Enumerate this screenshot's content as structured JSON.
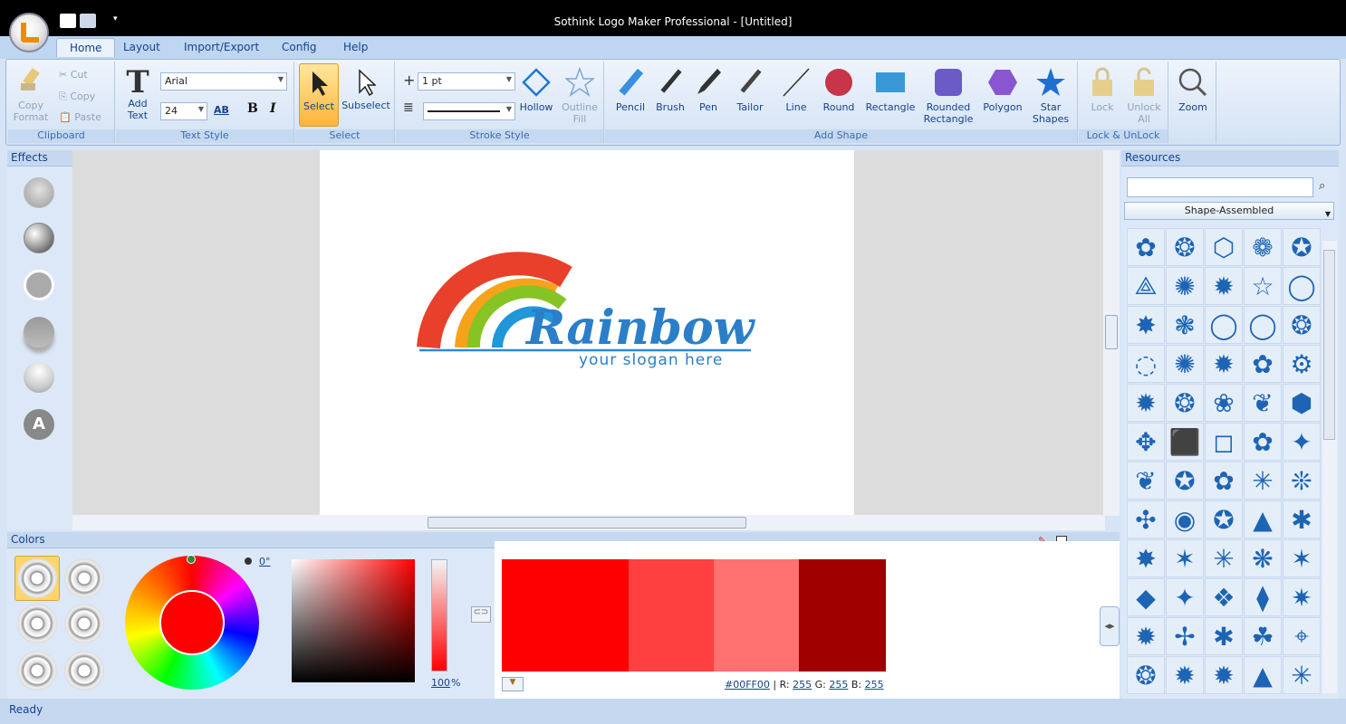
{
  "app": {
    "title": "Sothink Logo Maker Professional - [Untitled]"
  },
  "tabs": [
    {
      "label": "Home",
      "active": true
    },
    {
      "label": "Layout"
    },
    {
      "label": "Import/Export"
    },
    {
      "label": "Config"
    },
    {
      "label": "Help"
    }
  ],
  "ribbon": {
    "clipboard": {
      "label": "Clipboard",
      "cut": "Cut",
      "copy": "Copy",
      "paste": "Paste",
      "copy_format_1": "Copy",
      "copy_format_2": "Format"
    },
    "text_style": {
      "label": "Text Style",
      "add_text_1": "Add",
      "add_text_2": "Text",
      "font": "Arial",
      "size": "24",
      "bold": "B",
      "italic": "I",
      "spacing": "AB"
    },
    "select": {
      "label": "Select",
      "select": "Select",
      "subselect": "Subselect"
    },
    "stroke": {
      "label": "Stroke Style",
      "width": "1 pt",
      "hollow": "Hollow",
      "outline_fill_1": "Outline",
      "outline_fill_2": "Fill"
    },
    "add_shape": {
      "label": "Add Shape",
      "pencil": "Pencil",
      "brush": "Brush",
      "pen": "Pen",
      "tailor": "Tailor",
      "line": "Line",
      "round": "Round",
      "rectangle": "Rectangle",
      "rounded_1": "Rounded",
      "rounded_2": "Rectangle",
      "polygon": "Polygon",
      "star_1": "Star",
      "star_2": "Shapes"
    },
    "lock": {
      "label": "Lock & UnLock",
      "lock": "Lock",
      "unlock_1": "Unlock",
      "unlock_2": "All"
    },
    "zoom": {
      "label": "Zoom"
    }
  },
  "effects": {
    "title": "Effects"
  },
  "logo": {
    "name": "Rainbow",
    "slogan": "your slogan here"
  },
  "resources": {
    "title": "Resources",
    "search_placeholder": "",
    "category": "Shape-Assembled"
  },
  "shape_glyphs": [
    "✿",
    "❂",
    "⬡",
    "❁",
    "✪",
    "⟁",
    "✺",
    "✹",
    "☆",
    "◯",
    "✸",
    "❃",
    "◯",
    "◯",
    "❂",
    "◌",
    "✺",
    "✹",
    "✿",
    "⚙",
    "✹",
    "❂",
    "❀",
    "❦",
    "⬢",
    "✥",
    "⬛",
    "◻",
    "✿",
    "✦",
    "❦",
    "✪",
    "✿",
    "✳",
    "❊",
    "✣",
    "◉",
    "✪",
    "▲",
    "✱",
    "✸",
    "✶",
    "✳",
    "❋",
    "✶",
    "◆",
    "✦",
    "❖",
    "⧫",
    "✷",
    "✹",
    "✢",
    "✱",
    "☘",
    "⌖",
    "❂",
    "✹",
    "✹",
    "▲",
    "✳"
  ],
  "colors": {
    "title": "Colors",
    "angle": "0°",
    "opacity": "100",
    "opacity_unit": "%",
    "hex": "#00FF00",
    "r_label": "R:",
    "r": "255",
    "g_label": "G:",
    "g": "255",
    "b_label": "B:",
    "b": "255",
    "swatches": [
      "#ff0000",
      "#ff4040",
      "#ff7070",
      "#a00000"
    ],
    "current": "#ff0000"
  },
  "status": {
    "text": "Ready"
  }
}
